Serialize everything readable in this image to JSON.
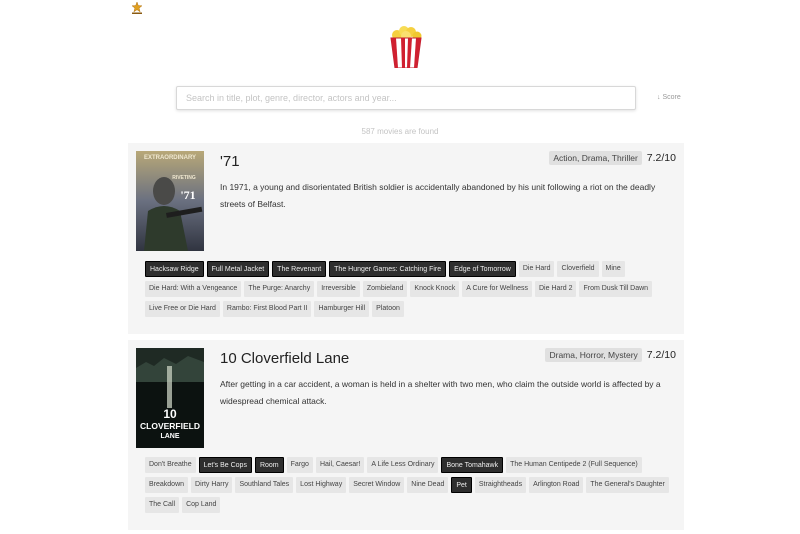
{
  "search": {
    "placeholder": "Search in title, plot, genre, director, actors and year..."
  },
  "sort_label": "↓ Score",
  "results_count": "587 movies are found",
  "movies": [
    {
      "title": "'71",
      "genres": "Action, Drama, Thriller",
      "rating": "7.2/10",
      "plot": "In 1971, a young and disorientated British soldier is accidentally abandoned by his unit following a riot on the deadly streets of Belfast.",
      "poster_text": [
        "EXTRAORDINARY",
        "RIVETING",
        "'71"
      ],
      "similar": [
        {
          "label": "Hacksaw Ridge",
          "seen": true
        },
        {
          "label": "Full Metal Jacket",
          "seen": true
        },
        {
          "label": "The Revenant",
          "seen": true
        },
        {
          "label": "The Hunger Games: Catching Fire",
          "seen": true
        },
        {
          "label": "Edge of Tomorrow",
          "seen": true
        },
        {
          "label": "Die Hard",
          "seen": false
        },
        {
          "label": "Cloverfield",
          "seen": false
        },
        {
          "label": "Mine",
          "seen": false
        },
        {
          "label": "Die Hard: With a Vengeance",
          "seen": false
        },
        {
          "label": "The Purge: Anarchy",
          "seen": false
        },
        {
          "label": "Irreversible",
          "seen": false
        },
        {
          "label": "Zombieland",
          "seen": false
        },
        {
          "label": "Knock Knock",
          "seen": false
        },
        {
          "label": "A Cure for Wellness",
          "seen": false
        },
        {
          "label": "Die Hard 2",
          "seen": false
        },
        {
          "label": "From Dusk Till Dawn",
          "seen": false
        },
        {
          "label": "Live Free or Die Hard",
          "seen": false
        },
        {
          "label": "Rambo: First Blood Part II",
          "seen": false
        },
        {
          "label": "Hamburger Hill",
          "seen": false
        },
        {
          "label": "Platoon",
          "seen": false
        }
      ]
    },
    {
      "title": "10 Cloverfield Lane",
      "genres": "Drama, Horror, Mystery",
      "rating": "7.2/10",
      "plot": "After getting in a car accident, a woman is held in a shelter with two men, who claim the outside world is affected by a widespread chemical attack.",
      "poster_text": [
        "10",
        "CLOVERFIELD",
        "LANE"
      ],
      "similar": [
        {
          "label": "Don't Breathe",
          "seen": false
        },
        {
          "label": "Let's Be Cops",
          "seen": true
        },
        {
          "label": "Room",
          "seen": true
        },
        {
          "label": "Fargo",
          "seen": false
        },
        {
          "label": "Hail, Caesar!",
          "seen": false
        },
        {
          "label": "A Life Less Ordinary",
          "seen": false
        },
        {
          "label": "Bone Tomahawk",
          "seen": true
        },
        {
          "label": "The Human Centipede 2 (Full Sequence)",
          "seen": false
        },
        {
          "label": "Breakdown",
          "seen": false
        },
        {
          "label": "Dirty Harry",
          "seen": false
        },
        {
          "label": "Southland Tales",
          "seen": false
        },
        {
          "label": "Lost Highway",
          "seen": false
        },
        {
          "label": "Secret Window",
          "seen": false
        },
        {
          "label": "Nine Dead",
          "seen": false
        },
        {
          "label": "Pet",
          "seen": true
        },
        {
          "label": "Straightheads",
          "seen": false
        },
        {
          "label": "Arlington Road",
          "seen": false
        },
        {
          "label": "The General's Daughter",
          "seen": false
        },
        {
          "label": "The Call",
          "seen": false
        },
        {
          "label": "Cop Land",
          "seen": false
        }
      ]
    }
  ],
  "icons": {
    "corner": "star-icon",
    "logo": "popcorn-icon"
  },
  "colors": {
    "card_bg": "#f5f5f5",
    "tag_seen_bg": "#2e2e2e",
    "tag_bg": "#e6e6e6",
    "popcorn_red": "#d02030",
    "popcorn_yellow": "#f5d040"
  }
}
